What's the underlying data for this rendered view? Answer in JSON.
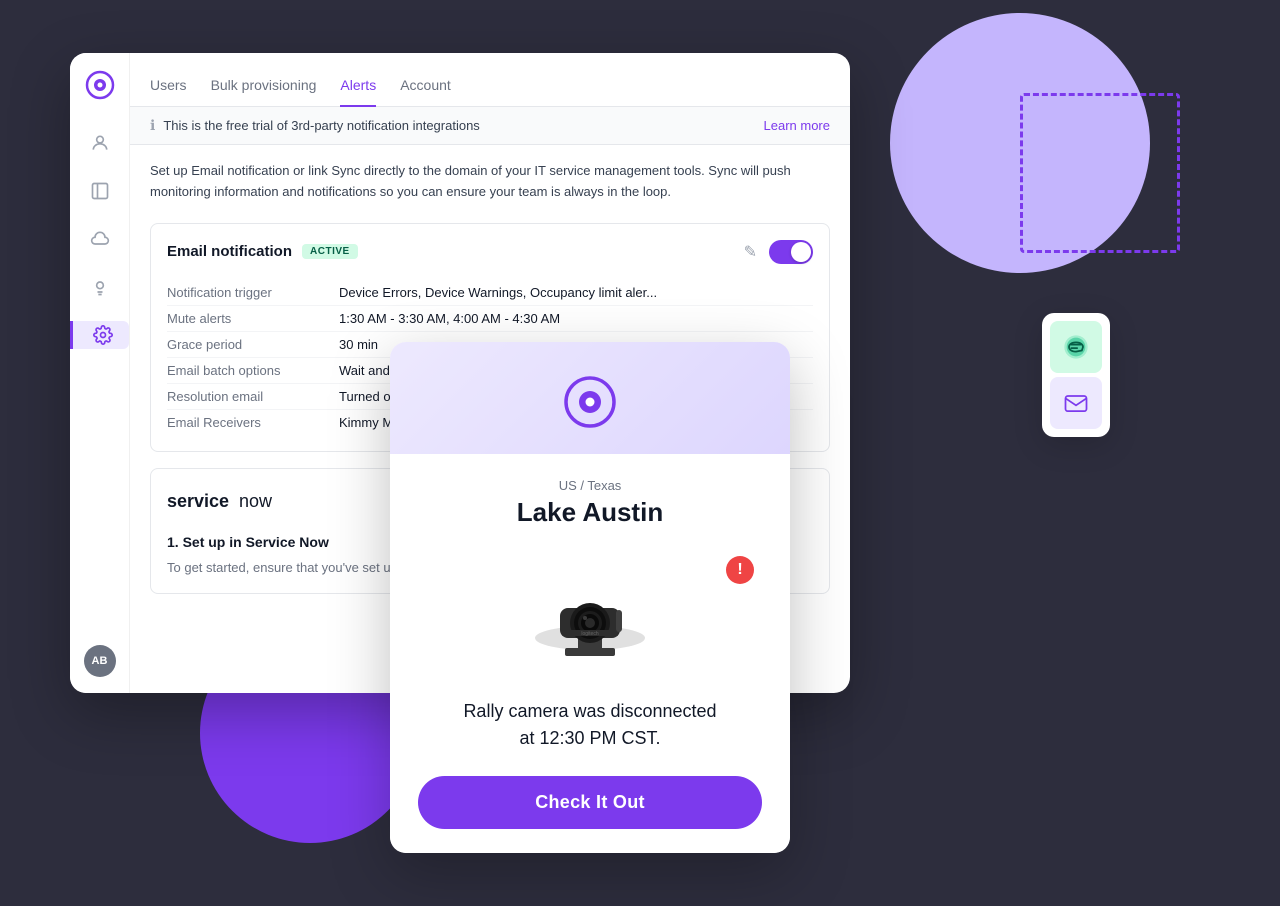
{
  "app": {
    "logo_text": "Sync",
    "sidebar_avatar": "AB"
  },
  "nav": {
    "tabs": [
      {
        "label": "Users",
        "active": false
      },
      {
        "label": "Bulk provisioning",
        "active": false
      },
      {
        "label": "Alerts",
        "active": true
      },
      {
        "label": "Account",
        "active": false
      }
    ]
  },
  "banner": {
    "message": "This is the free trial of 3rd-party notification integrations",
    "learn_more": "Learn more"
  },
  "description": "Set up Email notification or link Sync directly to the domain of your IT service management tools. Sync will push monitoring information and notifications so you can ensure your team is always in the loop.",
  "email_notification": {
    "title": "Email notification",
    "badge": "ACTIVE",
    "details": [
      {
        "label": "Notification trigger",
        "value": "Device Errors, Device Warnings, Occupancy limit aler..."
      },
      {
        "label": "Mute alerts",
        "value": "1:30 AM - 3:30 AM, 4:00 AM - 4:30 AM"
      },
      {
        "label": "Grace period",
        "value": "30 min"
      },
      {
        "label": "Email batch options",
        "value": "Wait and send in batch (4 Hours)"
      },
      {
        "label": "Resolution email",
        "value": "Turned on"
      },
      {
        "label": "Email Receivers",
        "value": "Kimmy McIlmorie, Smith Frederick"
      }
    ]
  },
  "servicenow": {
    "logo": "servicenow",
    "step_label": "1. Set up in Service Now",
    "description": "To get started, ensure that you've set up the Logitech Sync Service Now app here."
  },
  "notification_card": {
    "location": "US / Texas",
    "room_name": "Lake Austin",
    "message_line1": "Rally camera was disconnected",
    "message_line2": "at 12:30 PM CST.",
    "cta_button": "Check It Out"
  },
  "side_icons": {
    "chat_icon": "💬",
    "email_icon": "✉"
  },
  "icons": {
    "info": "ℹ",
    "edit": "✎",
    "user": "👤",
    "book": "📖",
    "cloud": "☁",
    "bulb": "💡",
    "gear": "⚙"
  }
}
